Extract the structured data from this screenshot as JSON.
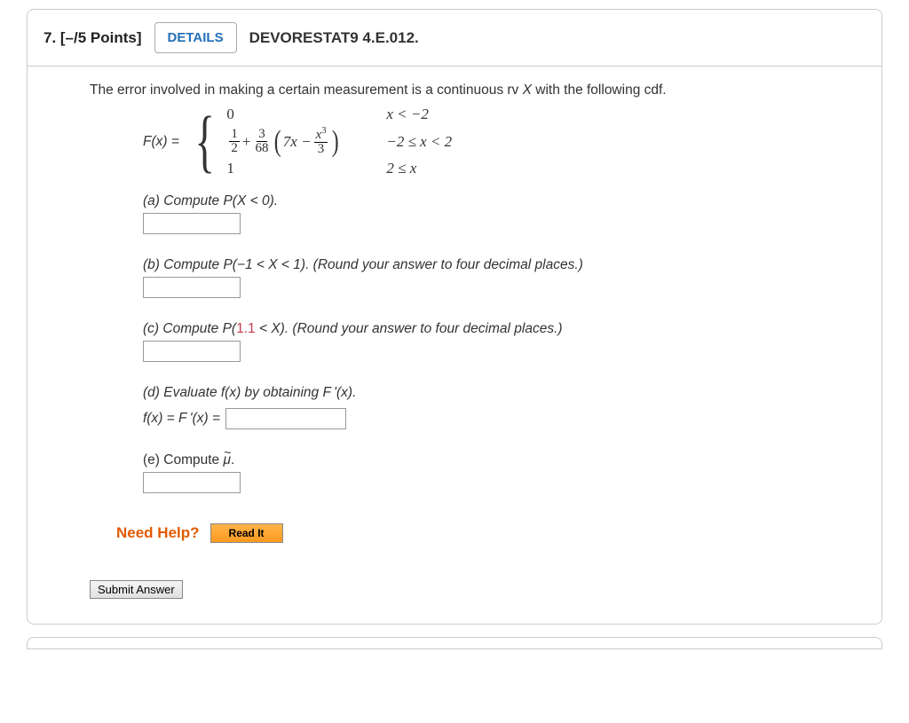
{
  "header": {
    "qnum_points": "7.  [–/5 Points]",
    "details_label": "DETAILS",
    "source": "DEVORESTAT9 4.E.012."
  },
  "intro": {
    "text_before_X": "The error involved in making a certain measurement is a continuous rv ",
    "rv": "X",
    "text_after_X": " with the following cdf."
  },
  "formula": {
    "fx_label": "F(x) = ",
    "case1_expr": "0",
    "case1_cond": "x < −2",
    "case2_frac1_num": "1",
    "case2_frac1_den": "2",
    "case2_plus": " + ",
    "case2_frac2_num": "3",
    "case2_frac2_den": "68",
    "case2_inner_a": "7x − ",
    "case2_inner_frac_num": "x",
    "case2_inner_frac_num_sup": "3",
    "case2_inner_frac_den": "3",
    "case2_cond": "−2 ≤ x < 2",
    "case3_expr": "1",
    "case3_cond": "2 ≤ x"
  },
  "parts": {
    "a": "(a) Compute P(X < 0).",
    "b": "(b) Compute P(−1 < X < 1). (Round your answer to four decimal places.)",
    "c_before": "(c) Compute P(",
    "c_red": "1.1",
    "c_after": " < X). (Round your answer to four decimal places.)",
    "d": "(d) Evaluate f(x) by obtaining F '(x).",
    "d_line": "f(x) = F '(x) = ",
    "e_before": "(e) Compute ",
    "e_mu": "μ",
    "e_after": "."
  },
  "help": {
    "need_help": "Need Help?",
    "read_it": "Read It"
  },
  "submit": {
    "label": "Submit Answer"
  }
}
